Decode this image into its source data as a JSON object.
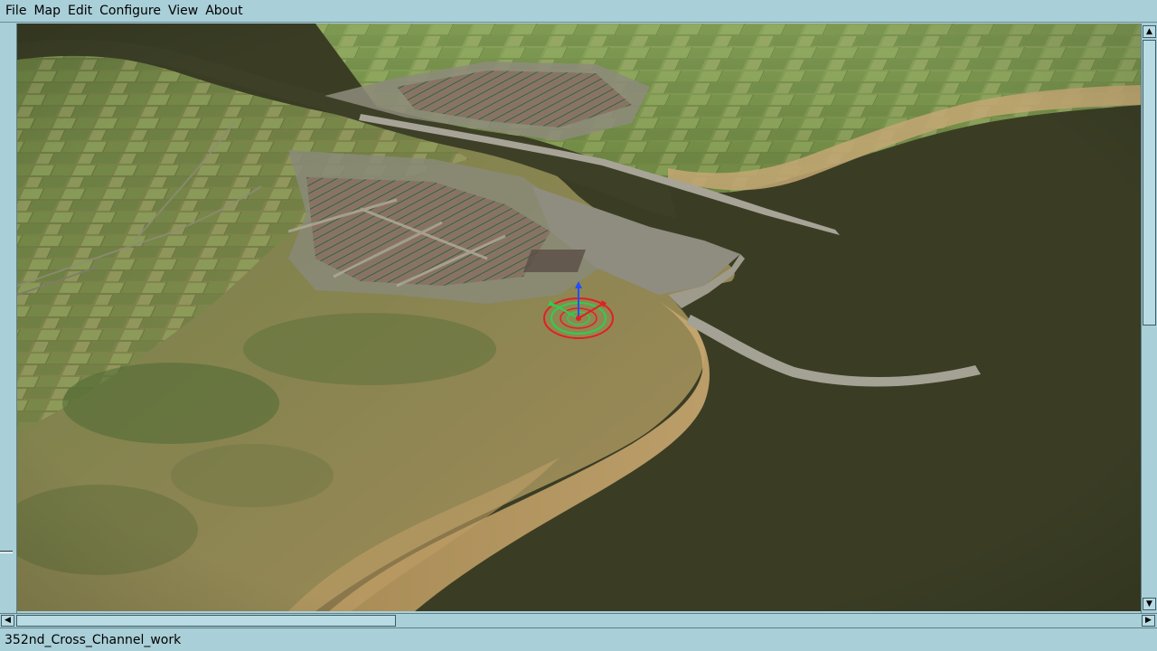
{
  "menubar": {
    "items": [
      {
        "label": "File"
      },
      {
        "label": "Map"
      },
      {
        "label": "Edit"
      },
      {
        "label": "Configure"
      },
      {
        "label": "View"
      },
      {
        "label": "About"
      }
    ]
  },
  "statusbar": {
    "text": "352nd_Cross_Channel_work"
  },
  "scrollbars": {
    "up_arrow": "▲",
    "down_arrow": "▼",
    "left_arrow": "◀",
    "right_arrow": "▶"
  },
  "colors": {
    "chrome": "#a9cfd8",
    "water": "#3a3d24",
    "farmland": "#7c9a4f",
    "beach": "#b7995e",
    "town": "#8d8a7c",
    "gizmo_red": "#e02020",
    "gizmo_green": "#2bd24a",
    "gizmo_blue": "#2050ff"
  }
}
